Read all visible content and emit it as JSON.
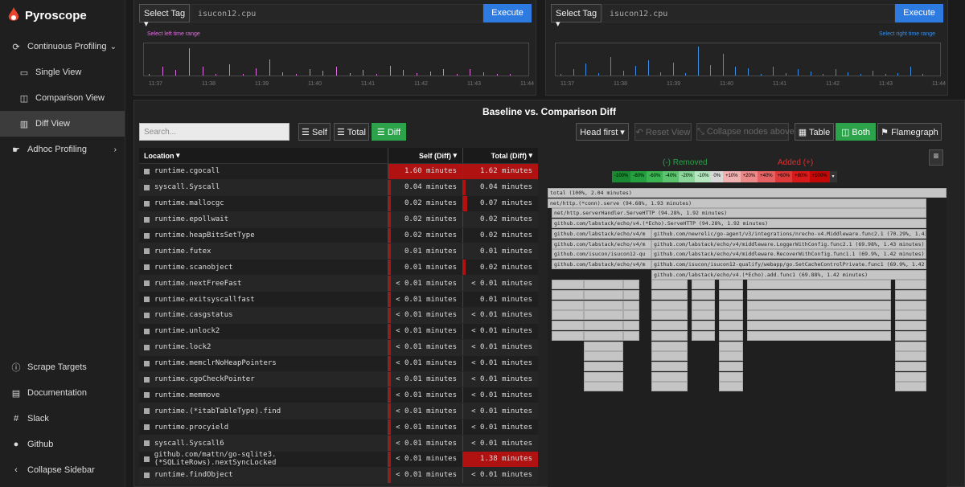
{
  "app": {
    "name": "Pyroscope"
  },
  "sidebar": {
    "items": [
      {
        "label": "Continuous Profiling",
        "icon": "sync-icon"
      },
      {
        "label": "Single View",
        "icon": "single-view-icon"
      },
      {
        "label": "Comparison View",
        "icon": "comparison-icon"
      },
      {
        "label": "Diff View",
        "icon": "diff-chart-icon"
      },
      {
        "label": "Adhoc Profiling",
        "icon": "hand-icon"
      }
    ],
    "bottom": [
      {
        "label": "Scrape Targets",
        "icon": "info-icon"
      },
      {
        "label": "Documentation",
        "icon": "document-icon"
      },
      {
        "label": "Slack",
        "icon": "slack-icon"
      },
      {
        "label": "Github",
        "icon": "github-icon"
      },
      {
        "label": "Collapse Sidebar",
        "icon": "chevron-left-icon"
      }
    ]
  },
  "left": {
    "tag": "Select Tag",
    "query": "isucon12.cpu",
    "execute": "Execute",
    "range_label": "Select left time range",
    "accent": "#e070e0",
    "ticks": [
      "11:37",
      "11:38",
      "11:39",
      "11:40",
      "11:41",
      "11:42",
      "11:43",
      "11:44"
    ],
    "bars": [
      0.05,
      0.28,
      0.18,
      0.9,
      0.3,
      0.05,
      0.38,
      0.04,
      0.25,
      0.52,
      0.1,
      0.05,
      0.22,
      0.15,
      0.28,
      0.08,
      0.18,
      0.05,
      0.32,
      0.18,
      0.08,
      0.12,
      0.2,
      0.05,
      0.22,
      0.1,
      0.04,
      0.06
    ]
  },
  "right": {
    "tag": "Select Tag",
    "query": "isucon12.cpu",
    "execute": "Execute",
    "range_label": "Select right time range",
    "accent": "#3a8ee6",
    "ticks": [
      "11:37",
      "11:38",
      "11:39",
      "11:40",
      "11:41",
      "11:42",
      "11:43",
      "11:44"
    ],
    "bars": [
      0.05,
      0.22,
      0.4,
      0.08,
      0.6,
      0.15,
      0.32,
      0.5,
      0.1,
      0.42,
      0.07,
      0.95,
      0.35,
      0.72,
      0.28,
      0.25,
      0.05,
      0.3,
      0.08,
      0.2,
      0.12,
      0.05,
      0.2,
      0.1,
      0.04,
      0.15,
      0.05,
      0.08,
      0.3,
      0.06
    ]
  },
  "diff": {
    "title": "Baseline vs. Comparison Diff",
    "search_placeholder": "Search...",
    "view_buttons": {
      "self": "Self",
      "total": "Total",
      "diff": "Diff"
    },
    "head_first": "Head first",
    "reset_view": "Reset View",
    "collapse_nodes": "Collapse nodes above",
    "modes": {
      "table": "Table",
      "both": "Both",
      "flamegraph": "Flamegraph"
    },
    "removed": "(-) Removed",
    "added": "Added (+)",
    "scale": [
      "-100%",
      "-80%",
      "-60%",
      "-40%",
      "-20%",
      "-10%",
      "0%",
      "+10%",
      "+20%",
      "+40%",
      "+60%",
      "+80%",
      "+100%"
    ],
    "columns": {
      "location": "Location",
      "self": "Self (Diff)",
      "total": "Total (Diff)"
    },
    "rows": [
      {
        "name": "runtime.cgocall",
        "self": "1.60 minutes",
        "total": "1.62 minutes",
        "self_hl": 1,
        "total_hl": 1
      },
      {
        "name": "syscall.Syscall",
        "self": "0.04 minutes",
        "total": "0.04 minutes",
        "self_hl": 0.03,
        "total_hl": 0.03
      },
      {
        "name": "runtime.mallocgc",
        "self": "0.02 minutes",
        "total": "0.07 minutes",
        "self_hl": 0.02,
        "total_hl": 0.05
      },
      {
        "name": "runtime.epollwait",
        "self": "0.02 minutes",
        "total": "0.02 minutes",
        "self_hl": 0.02,
        "total_hl": 0
      },
      {
        "name": "runtime.heapBitsSetType",
        "self": "0.02 minutes",
        "total": "0.02 minutes",
        "self_hl": 0.02,
        "total_hl": 0
      },
      {
        "name": "runtime.futex",
        "self": "0.01 minutes",
        "total": "0.01 minutes",
        "self_hl": 0.02,
        "total_hl": 0
      },
      {
        "name": "runtime.scanobject",
        "self": "0.01 minutes",
        "total": "0.02 minutes",
        "self_hl": 0.02,
        "total_hl": 0.02
      },
      {
        "name": "runtime.nextFreeFast",
        "self": "< 0.01 minutes",
        "total": "< 0.01 minutes",
        "self_hl": 0.01,
        "total_hl": 0
      },
      {
        "name": "runtime.exitsyscallfast",
        "self": "< 0.01 minutes",
        "total": "0.01 minutes",
        "self_hl": 0.01,
        "total_hl": 0
      },
      {
        "name": "runtime.casgstatus",
        "self": "< 0.01 minutes",
        "total": "< 0.01 minutes",
        "self_hl": 0.01,
        "total_hl": 0
      },
      {
        "name": "runtime.unlock2",
        "self": "< 0.01 minutes",
        "total": "< 0.01 minutes",
        "self_hl": 0.01,
        "total_hl": 0
      },
      {
        "name": "runtime.lock2",
        "self": "< 0.01 minutes",
        "total": "< 0.01 minutes",
        "self_hl": 0.01,
        "total_hl": 0
      },
      {
        "name": "runtime.memclrNoHeapPointers",
        "self": "< 0.01 minutes",
        "total": "< 0.01 minutes",
        "self_hl": 0.01,
        "total_hl": 0
      },
      {
        "name": "runtime.cgoCheckPointer",
        "self": "< 0.01 minutes",
        "total": "< 0.01 minutes",
        "self_hl": 0.01,
        "total_hl": 0
      },
      {
        "name": "runtime.memmove",
        "self": "< 0.01 minutes",
        "total": "< 0.01 minutes",
        "self_hl": 0.01,
        "total_hl": 0
      },
      {
        "name": "runtime.(*itabTableType).find",
        "self": "< 0.01 minutes",
        "total": "< 0.01 minutes",
        "self_hl": 0.01,
        "total_hl": 0
      },
      {
        "name": "runtime.procyield",
        "self": "< 0.01 minutes",
        "total": "< 0.01 minutes",
        "self_hl": 0.01,
        "total_hl": 0
      },
      {
        "name": "syscall.Syscall6",
        "self": "< 0.01 minutes",
        "total": "< 0.01 minutes",
        "self_hl": 0.01,
        "total_hl": 0
      },
      {
        "name": "github.com/mattn/go-sqlite3.(*SQLiteRows).nextSyncLocked",
        "self": "< 0.01 minutes",
        "total": "1.38 minutes",
        "self_hl": 0.01,
        "total_hl": 1
      },
      {
        "name": "runtime.findObject",
        "self": "< 0.01 minutes",
        "total": "< 0.01 minutes",
        "self_hl": 0.01,
        "total_hl": 0
      }
    ],
    "flame": [
      {
        "t": "total (100%, 2.04 minutes)",
        "l": 0,
        "w": 1,
        "d": 0
      },
      {
        "t": "net/http.(*conn).serve (94.68%, 1.93 minutes)",
        "l": 0,
        "w": 0.95,
        "d": 1
      },
      {
        "t": "net/http.serverHandler.ServeHTTP (94.28%, 1.92 minutes)",
        "l": 0.01,
        "w": 0.94,
        "d": 2
      },
      {
        "t": "github.com/labstack/echo/v4.(*Echo).ServeHTTP (94.28%, 1.92 minutes)",
        "l": 0.01,
        "w": 0.94,
        "d": 3
      },
      {
        "t": "github.com/labstack/echo/v4/m",
        "l": 0.01,
        "w": 0.25,
        "d": 4
      },
      {
        "t": "github.com/newrelic/go-agent/v3/integrations/nrecho-v4.Middleware.func2.1 (70.29%, 1.43 minutes)",
        "l": 0.26,
        "w": 0.69,
        "d": 4
      },
      {
        "t": "github.com/labstack/echo/v4/m",
        "l": 0.01,
        "w": 0.25,
        "d": 5
      },
      {
        "t": "github.com/labstack/echo/v4/middleware.LoggerWithConfig.func2.1 (69.98%, 1.43 minutes)",
        "l": 0.26,
        "w": 0.69,
        "d": 5
      },
      {
        "t": "github.com/isucon/isucon12-qu",
        "l": 0.01,
        "w": 0.25,
        "d": 6
      },
      {
        "t": "github.com/labstack/echo/v4/middleware.RecoverWithConfig.func1.1 (69.9%, 1.42 minutes)",
        "l": 0.26,
        "w": 0.69,
        "d": 6
      },
      {
        "t": "github.com/labstack/echo/v4/m",
        "l": 0.01,
        "w": 0.25,
        "d": 7
      },
      {
        "t": "github.com/isucon/isucon12-qualify/webapp/go.SetCacheControlPrivate.func1 (69.9%, 1.42 minutes)",
        "l": 0.26,
        "w": 0.69,
        "d": 7
      },
      {
        "t": "github.com/labstack/echo/v4.(*Echo).add.func1 (69.88%, 1.42 minutes)",
        "l": 0.26,
        "w": 0.69,
        "d": 8
      }
    ]
  }
}
